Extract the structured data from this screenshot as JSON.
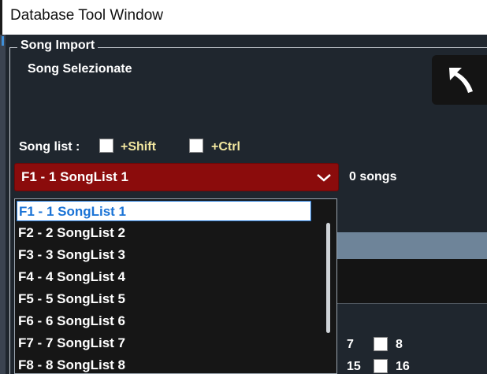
{
  "window": {
    "title": "Database Tool Window"
  },
  "song_import": {
    "group_label": "Song Import",
    "subtitle": "Song Selezionate",
    "song_list_label": "Song list :",
    "shift_label": "+Shift",
    "ctrl_label": "+Ctrl",
    "selected_songlist": "F1 - 1 SongList 1",
    "songs_count": "0 songs",
    "dropdown_options": [
      "F1 - 1 SongList 1",
      "F2 - 2 SongList 2",
      "F3 - 3 SongList 3",
      "F4 - 4 SongList 4",
      "F5 - 5 SongList 5",
      "F6 - 6 SongList 6",
      "F7 - 7 SongList 7",
      "F8 - 8 SongList 8"
    ],
    "band_text": ")",
    "grid_labels": [
      "7",
      "8",
      "15",
      "16"
    ]
  },
  "colors": {
    "background": "#1f262e",
    "combo_bg": "#8b0c0c",
    "selection_text": "#1a73d6",
    "modifier_text": "#f2e7a0"
  },
  "icons": {
    "back_button": "undo-arrow-icon",
    "combo_chevron": "chevron-down-icon"
  }
}
